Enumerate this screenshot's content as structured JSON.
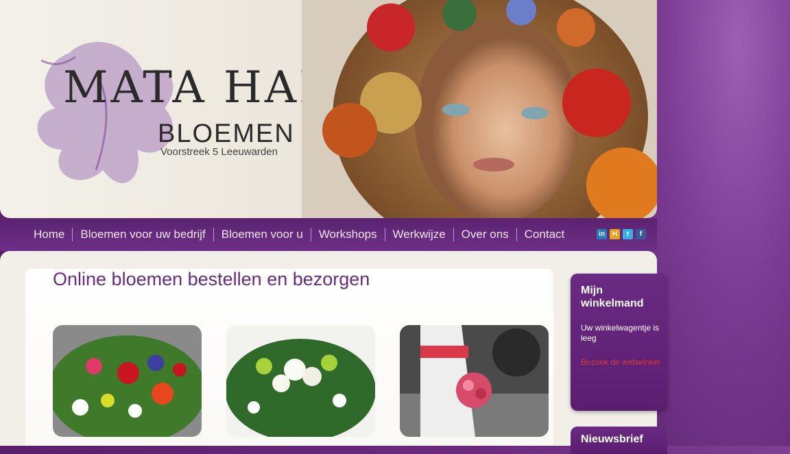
{
  "logo": {
    "title": "MATA HARI",
    "subtitle": "BLOEMEN",
    "address": "Voorstreek 5 Leeuwarden"
  },
  "nav": {
    "items": [
      "Home",
      "Bloemen voor uw bedrijf",
      "Bloemen voor u",
      "Workshops",
      "Werkwijze",
      "Over ons",
      "Contact"
    ]
  },
  "social": [
    "linkedin-icon",
    "hyves-icon",
    "twitter-icon",
    "facebook-icon"
  ],
  "main": {
    "title": "Online bloemen bestellen en bezorgen"
  },
  "cart": {
    "title": "Mijn winkelmand",
    "empty_text": "Uw winkelwagentje is leeg",
    "link": "Bezoek de webwinkel"
  },
  "newsletter": {
    "title": "Nieuwsbrief"
  },
  "colors": {
    "brand_purple": "#6a2a7e",
    "nav_bg": "#5b2371",
    "link_red": "#d83a3a"
  }
}
